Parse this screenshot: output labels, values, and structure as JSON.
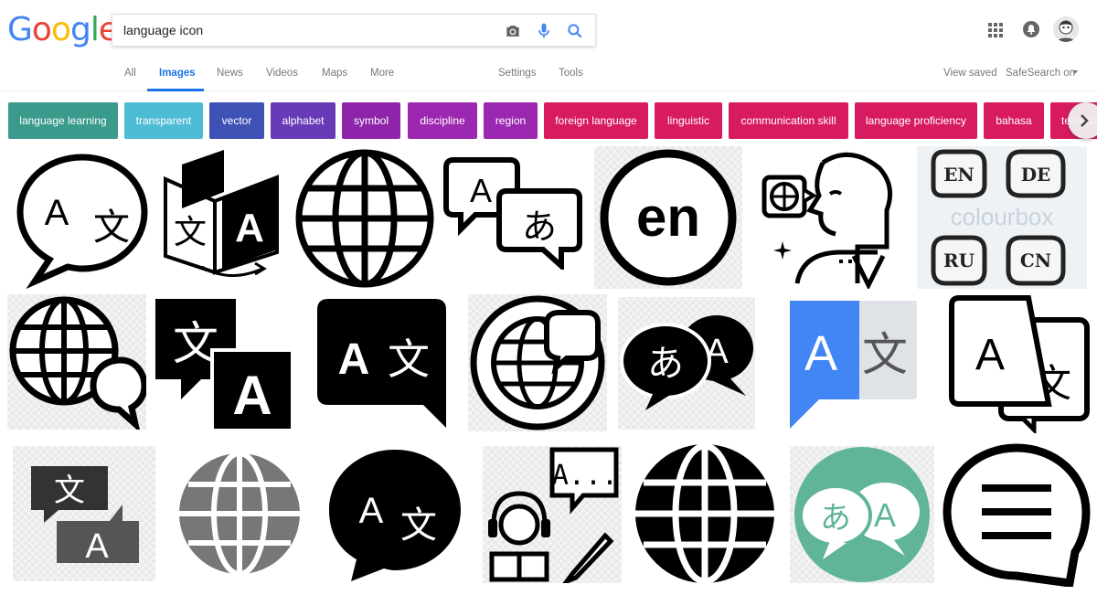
{
  "logo": {
    "text": "Google",
    "letters": [
      "G",
      "o",
      "o",
      "g",
      "l",
      "e"
    ],
    "colors": [
      "#4285f4",
      "#ea4335",
      "#fbbc05",
      "#4285f4",
      "#34a853",
      "#ea4335"
    ]
  },
  "search": {
    "query": "language icon"
  },
  "header_icons": [
    "camera-icon",
    "mic-icon",
    "search-icon",
    "apps-icon",
    "notifications-icon",
    "account-avatar"
  ],
  "tabs": {
    "items": [
      "All",
      "Images",
      "News",
      "Videos",
      "Maps",
      "More"
    ],
    "active": "Images",
    "settings": "Settings",
    "tools": "Tools",
    "view_saved": "View saved",
    "safesearch": "SafeSearch on"
  },
  "chips": [
    {
      "label": "language learning",
      "color": "#3a9a8c"
    },
    {
      "label": "transparent",
      "color": "#4fbcd6"
    },
    {
      "label": "vector",
      "color": "#3f51b5"
    },
    {
      "label": "alphabet",
      "color": "#673ab7"
    },
    {
      "label": "symbol",
      "color": "#8e24aa"
    },
    {
      "label": "discipline",
      "color": "#9c27b0"
    },
    {
      "label": "region",
      "color": "#9c27b0"
    },
    {
      "label": "foreign language",
      "color": "#d81b60"
    },
    {
      "label": "linguistic",
      "color": "#d81b60"
    },
    {
      "label": "communication skill",
      "color": "#d81b60"
    },
    {
      "label": "language proficiency",
      "color": "#d81b60"
    },
    {
      "label": "bahasa",
      "color": "#d81b60"
    },
    {
      "label": "technology",
      "color": "#d81b60"
    }
  ],
  "thumbnails": {
    "row1": [
      "speech-bubble-a-wen-icon",
      "book-translate-icon",
      "globe-icon",
      "speech-bubbles-a-hiragana-icon",
      "en-circle-icon",
      "speaking-head-globe-icon",
      "language-badges-icon"
    ],
    "row2": [
      "globe-chat-icon",
      "translate-squares-icon",
      "a-wen-bubble-icon",
      "globe-speech-circle-icon",
      "hiragana-a-bubbles-icon",
      "google-translate-icon",
      "translate-cards-icon"
    ],
    "row3": [
      "translate-bubbles-icon",
      "gray-globe-icon",
      "black-bubble-a-wen-icon",
      "headset-chat-icon",
      "black-globe-icon",
      "teal-hiragana-a-icon",
      "chat-lines-icon"
    ],
    "badges": [
      "EN",
      "DE",
      "RU",
      "CN"
    ],
    "watermark": "colourbox",
    "labels": {
      "a": "A",
      "wen": "文",
      "hira": "あ",
      "en": "en",
      "ellipsis": "A..."
    }
  }
}
